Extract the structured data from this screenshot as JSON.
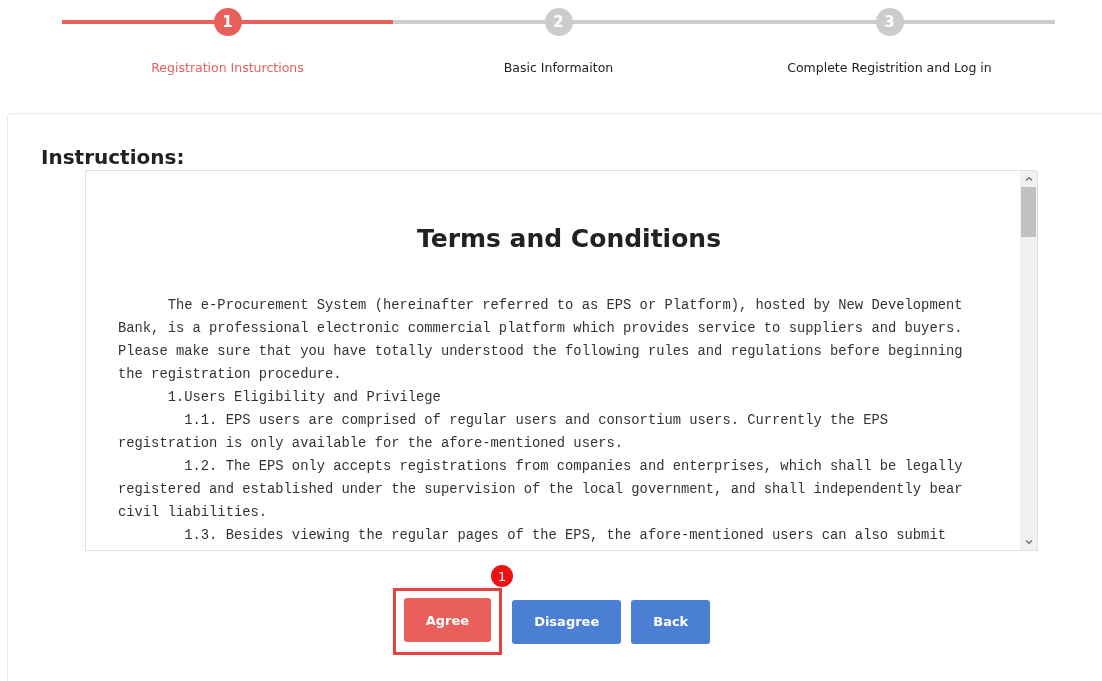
{
  "steps": [
    {
      "number": "1",
      "label": "Registration Insturctions",
      "selected": true
    },
    {
      "number": "2",
      "label": "Basic Informaiton",
      "selected": false
    },
    {
      "number": "3",
      "label": "Complete Registrition and Log in",
      "selected": false
    }
  ],
  "section_title": "Instructions:",
  "document": {
    "title": "Terms and Conditions",
    "paragraphs": [
      {
        "kind": "body",
        "text": "The e-Procurement System (hereinafter referred to as EPS or Platform), hosted by New Development Bank, is a professional electronic commercial platform which provides service to suppliers and buyers. Please make sure that you have totally understood the following rules and regulations before beginning the registration procedure."
      },
      {
        "kind": "heading",
        "text": "1.Users Eligibility and Privilege"
      },
      {
        "kind": "item",
        "text": "1.1. EPS users are comprised of regular users and consortium users. Currently the EPS registration is only available for the afore-mentioned users."
      },
      {
        "kind": "item",
        "text": "1.2. The EPS only accepts registrations from companies and enterprises, which shall be legally registered and established under the supervision of the local government, and shall independently bear civil liabilities."
      },
      {
        "kind": "item",
        "text": "1.3. Besides viewing the regular pages of the EPS, the afore-mentioned users can also submit"
      }
    ]
  },
  "buttons": [
    {
      "label": "Agree",
      "color": "#e85f5c"
    },
    {
      "label": "Disagree",
      "color": "#4a7fd4"
    },
    {
      "label": "Back",
      "color": "#4a7fd4"
    }
  ],
  "callout": {
    "number": "1"
  }
}
